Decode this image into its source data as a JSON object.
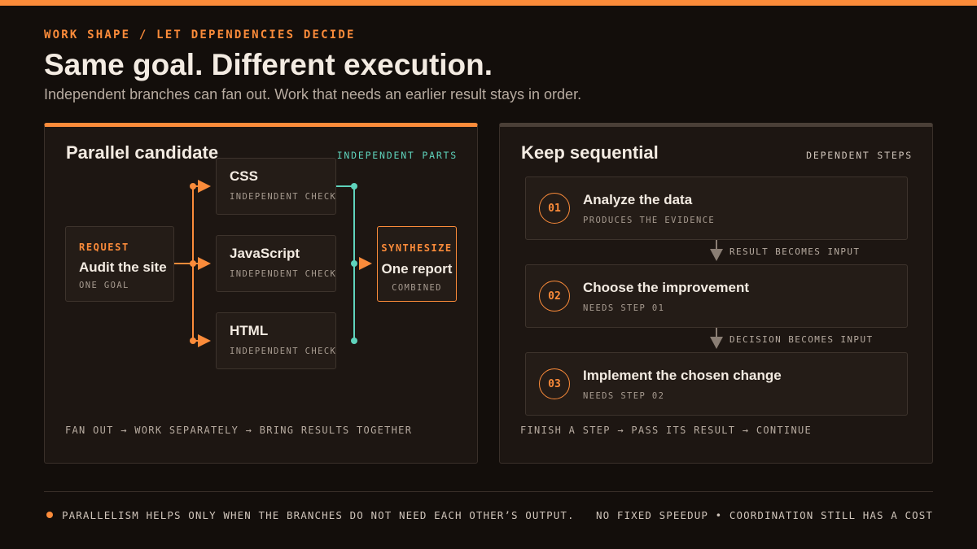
{
  "header": {
    "eyebrow": "WORK SHAPE / LET DEPENDENCIES DECIDE",
    "title": "Same goal. Different execution.",
    "subtitle": "Independent branches can fan out. Work that needs an earlier result stays in order."
  },
  "parallel": {
    "title": "Parallel candidate",
    "tag": "INDEPENDENT PARTS",
    "request": {
      "label": "REQUEST",
      "name": "Audit the site",
      "caption": "ONE GOAL"
    },
    "tasks": [
      {
        "name": "CSS",
        "caption": "INDEPENDENT CHECK"
      },
      {
        "name": "JavaScript",
        "caption": "INDEPENDENT CHECK"
      },
      {
        "name": "HTML",
        "caption": "INDEPENDENT CHECK"
      }
    ],
    "synth": {
      "label": "SYNTHESIZE",
      "name": "One report",
      "caption": "COMBINED"
    },
    "footer": "FAN OUT → WORK SEPARATELY → BRING RESULTS TOGETHER"
  },
  "sequential": {
    "title": "Keep sequential",
    "tag": "DEPENDENT STEPS",
    "steps": [
      {
        "num": "01",
        "name": "Analyze the data",
        "caption": "PRODUCES THE EVIDENCE"
      },
      {
        "num": "02",
        "name": "Choose the improvement",
        "caption": "NEEDS STEP 01"
      },
      {
        "num": "03",
        "name": "Implement the chosen change",
        "caption": "NEEDS STEP 02"
      }
    ],
    "connectors": [
      "RESULT BECOMES INPUT",
      "DECISION BECOMES INPUT"
    ],
    "footer": "FINISH A STEP → PASS ITS RESULT → CONTINUE"
  },
  "footer": {
    "left": "PARALLELISM HELPS ONLY WHEN THE BRANCHES DO NOT NEED EACH OTHER’S OUTPUT.",
    "right": "NO FIXED SPEEDUP • COORDINATION STILL HAS A COST"
  },
  "colors": {
    "accent": "#fb8b3a",
    "teal": "#5fd3bc",
    "background": "#130e0b",
    "panel": "#1d1612"
  }
}
